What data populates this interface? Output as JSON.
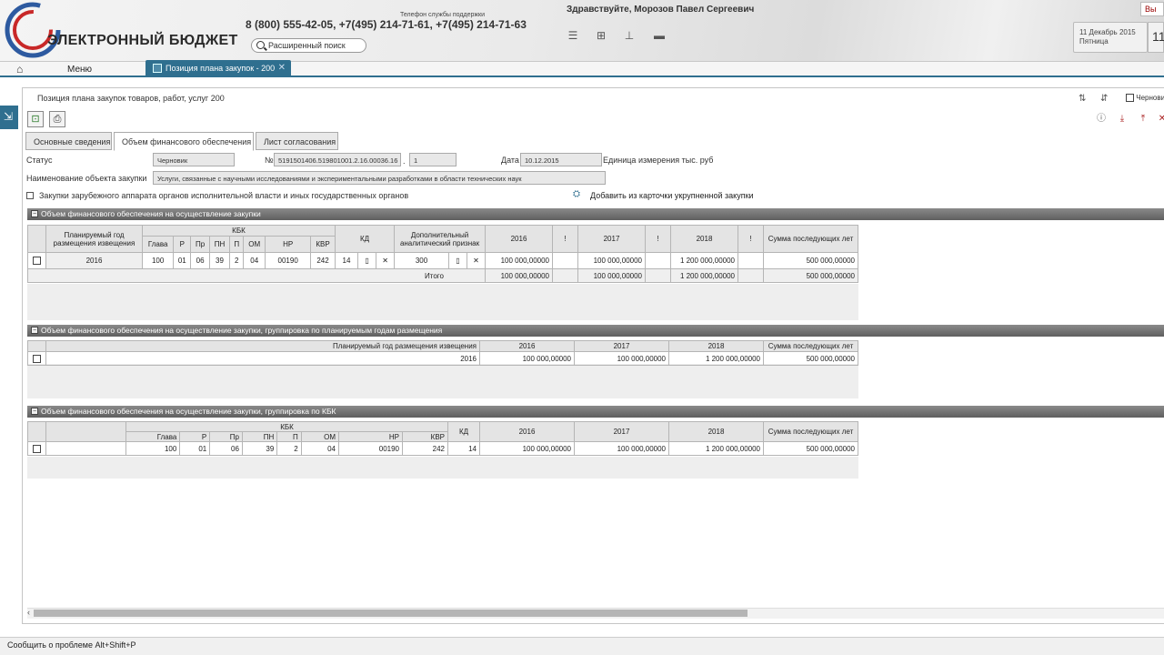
{
  "header": {
    "brand": "ЭЛЕКТРОННЫЙ БЮДЖЕТ",
    "support_label": "Телефон службы поддержки",
    "phones": "8 (800) 555-42-05, +7(495) 214-71-61, +7(495) 214-71-63",
    "search_placeholder": "Расширенный поиск",
    "greeting": "Здравствуйте, Морозов Павел Сергеевич",
    "date_line1": "11 Декабрь 2015",
    "date_line2": "Пятница",
    "date_num": "11",
    "exit_label": "Вы"
  },
  "nav": {
    "menu": "Меню",
    "active_tab": "Позиция плана закупок - 200"
  },
  "form": {
    "title": "Позиция плана закупок товаров, работ, услуг 200",
    "right_toggle": "Черновик",
    "tabs": [
      "Основные сведения",
      "Объем финансового обеспечения",
      "Лист согласования"
    ],
    "status_label": "Статус",
    "status_value": "Черновик",
    "no_label": "№",
    "no_value": "5191501406.519801001.2.16.00036.16",
    "no_suffix": "1",
    "date_label": "Дата",
    "date_value": "10.12.2015",
    "unit_label": "Единица измерения тыс. руб",
    "name_label": "Наименование объекта закупки",
    "name_value": "Услуги, связанные с научными исследованиями и экспериментальными разработками в области технических наук",
    "foreign_label": "Закупки зарубежного аппарата органов исполнительной власти и иных государственных органов",
    "add_link": "Добавить из карточки укрупненной закупки"
  },
  "section1": {
    "title": "Объем финансового обеспечения на осуществление закупки",
    "head": {
      "plan_year": "Планируемый год размещения извещения",
      "kbk": "КБК",
      "kbk_cols": [
        "Глава",
        "Р",
        "Пр",
        "ПН",
        "П",
        "ОМ",
        "НР",
        "КВР"
      ],
      "kd": "КД",
      "dop": "Дополнительный аналитический признак",
      "y1": "2016",
      "y2": "2017",
      "y3": "2018",
      "excl": "!",
      "future": "Сумма последующих лет"
    },
    "row": {
      "year": "2016",
      "kbk": [
        "100",
        "01",
        "06",
        "39",
        "2",
        "04",
        "00190",
        "242"
      ],
      "kd": "14",
      "dop": "300",
      "v2016": "100 000,00000",
      "v2017": "100 000,00000",
      "v2018": "1 200 000,00000",
      "future": "500 000,00000"
    },
    "total": {
      "label": "Итого",
      "v2016": "100 000,00000",
      "v2017": "100 000,00000",
      "v2018": "1 200 000,00000",
      "future": "500 000,00000"
    }
  },
  "section2": {
    "title": "Объем финансового обеспечения на осуществление закупки, группировка по планируемым годам размещения",
    "head": {
      "plan_year": "Планируемый год размещения извещения",
      "y1": "2016",
      "y2": "2017",
      "y3": "2018",
      "future": "Сумма последующих лет"
    },
    "row": {
      "year": "2016",
      "v2016": "100 000,00000",
      "v2017": "100 000,00000",
      "v2018": "1 200 000,00000",
      "future": "500 000,00000"
    }
  },
  "section3": {
    "title": "Объем финансового обеспечения на осуществление закупки, группировка по КБК",
    "head": {
      "kbk": "КБК",
      "kbk_cols": [
        "Глава",
        "Р",
        "Пр",
        "ПН",
        "П",
        "ОМ",
        "НР",
        "КВР"
      ],
      "kd": "КД",
      "y1": "2016",
      "y2": "2017",
      "y3": "2018",
      "future": "Сумма последующих лет"
    },
    "row": {
      "kbk": [
        "100",
        "01",
        "06",
        "39",
        "2",
        "04",
        "00190",
        "242"
      ],
      "kd": "14",
      "v2016": "100 000,00000",
      "v2017": "100 000,00000",
      "v2018": "1 200 000,00000",
      "future": "500 000,00000"
    }
  },
  "footer": {
    "report": "Сообщить о проблеме Alt+Shift+P"
  }
}
